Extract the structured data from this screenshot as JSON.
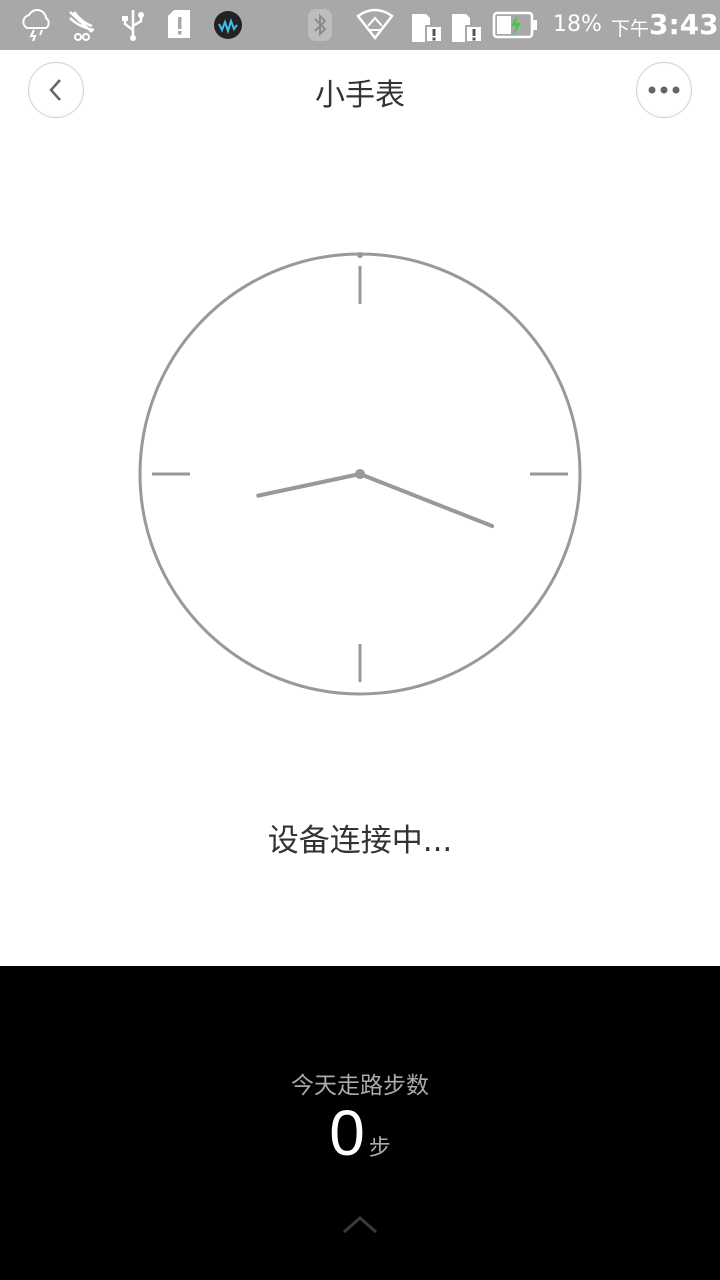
{
  "status_bar": {
    "icons": [
      "storm-cloud-icon",
      "bird-icon",
      "usb-icon",
      "sd-card-alert-icon",
      "music-app-icon",
      "bluetooth-icon",
      "wifi-icon",
      "sim1-alert-icon",
      "sim2-alert-icon",
      "battery-charging-icon"
    ],
    "battery_percent": "18%",
    "time_prefix": "下午",
    "time": "3:43"
  },
  "header": {
    "title": "小手表",
    "back_icon": "chevron-left-icon",
    "more_icon": "more-horizontal-icon"
  },
  "clock": {
    "hour": 3,
    "minute": 43,
    "face_color": "#999999"
  },
  "connection": {
    "status_text": "设备连接中..."
  },
  "steps": {
    "label": "今天走路步数",
    "value": "0",
    "unit": "步",
    "expand_icon": "chevron-up-icon"
  },
  "colors": {
    "status_bar_bg": "#a8a8a8",
    "panel_bg": "#000000",
    "accent_green": "#37d23a"
  }
}
